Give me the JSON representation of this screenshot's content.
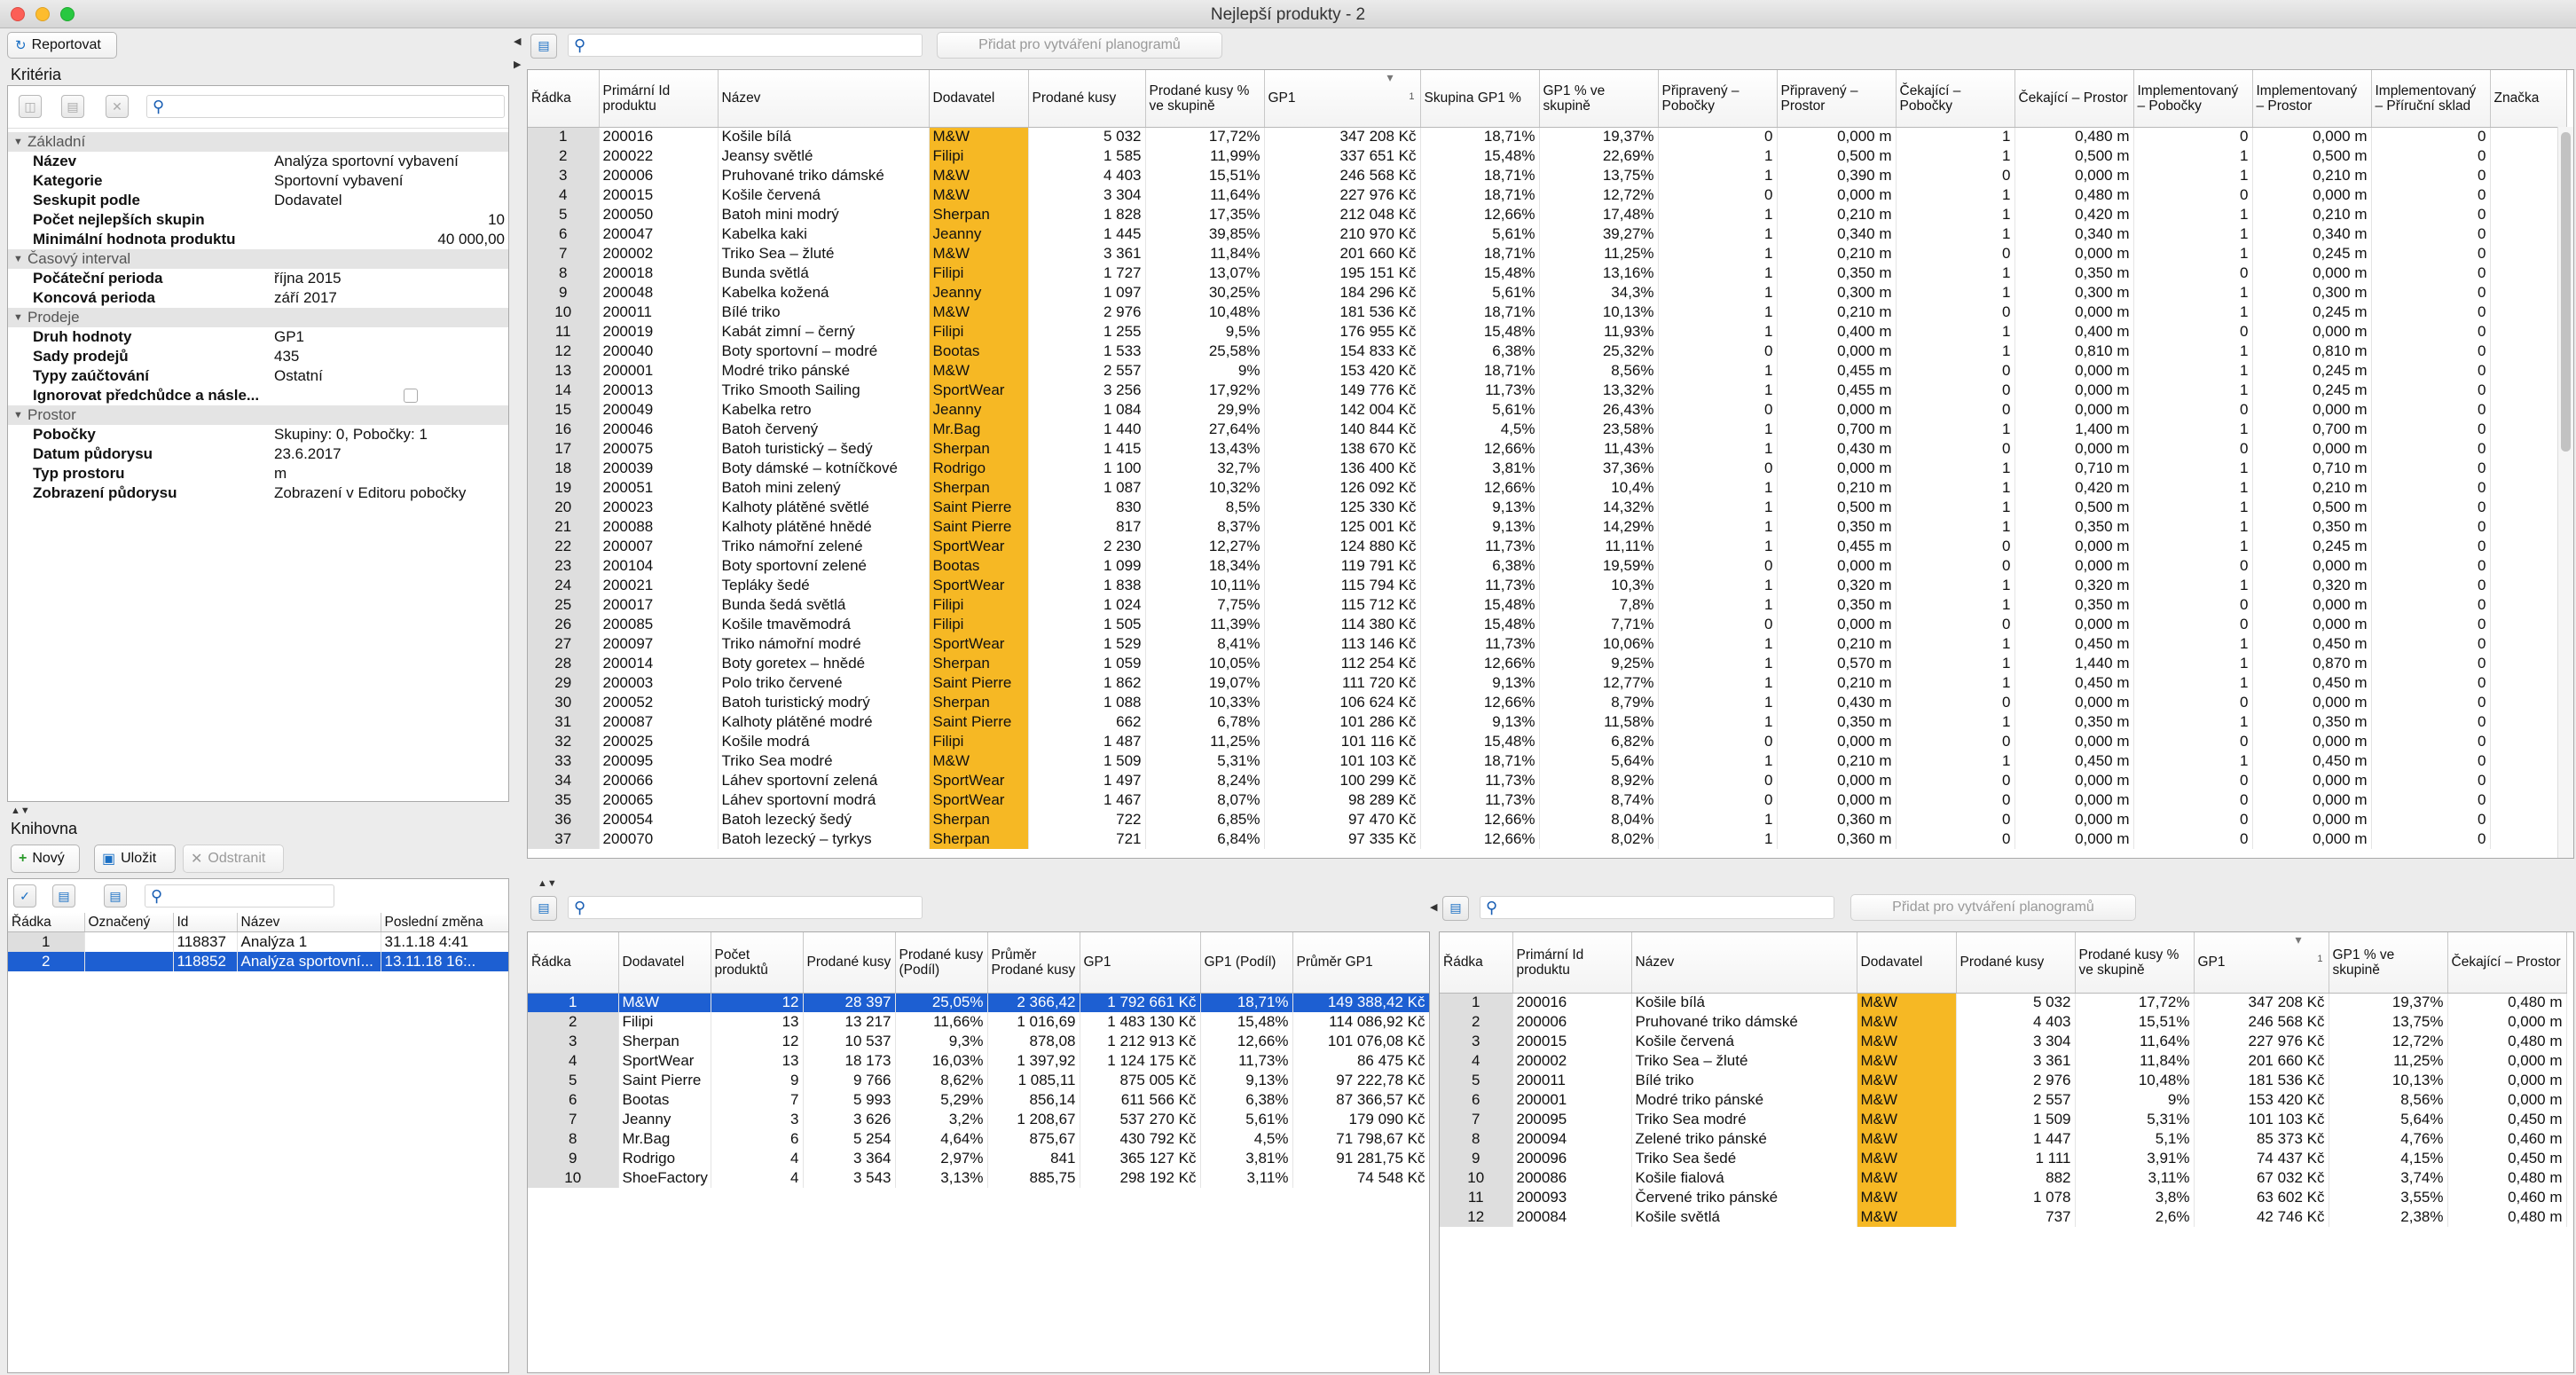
{
  "window": {
    "title": "Nejlepší produkty - 2"
  },
  "left": {
    "report_button": "Reportovat",
    "criteria_title": "Kritéria",
    "criteria_sections": [
      {
        "title": "Základní",
        "rows": [
          {
            "label": "Název",
            "value": "Analýza sportovní vybavení",
            "align": "left"
          },
          {
            "label": "Kategorie",
            "value": "Sportovní vybavení",
            "align": "left"
          },
          {
            "label": "Seskupit podle",
            "value": "Dodavatel",
            "align": "left"
          },
          {
            "label": "Počet nejlepších skupin",
            "value": "10",
            "align": "right"
          },
          {
            "label": "Minimální hodnota produktu",
            "value": "40 000,00",
            "align": "right"
          }
        ]
      },
      {
        "title": "Časový interval",
        "rows": [
          {
            "label": "Počáteční perioda",
            "value": "října 2015",
            "align": "left"
          },
          {
            "label": "Koncová perioda",
            "value": "září 2017",
            "align": "left"
          }
        ]
      },
      {
        "title": "Prodeje",
        "rows": [
          {
            "label": "Druh hodnoty",
            "value": "GP1",
            "align": "left"
          },
          {
            "label": "Sady prodejů",
            "value": "435",
            "align": "left"
          },
          {
            "label": "Typy zaúčtování",
            "value": "Ostatní",
            "align": "left"
          },
          {
            "label": "Ignorovat předchůdce a násle...",
            "value": "",
            "align": "checkbox"
          }
        ]
      },
      {
        "title": "Prostor",
        "rows": [
          {
            "label": "Pobočky",
            "value": "Skupiny: 0, Pobočky: 1",
            "align": "left"
          },
          {
            "label": "Datum půdorysu",
            "value": "23.6.2017",
            "align": "left"
          },
          {
            "label": "Typ prostoru",
            "value": "m",
            "align": "left"
          },
          {
            "label": "Zobrazení půdorysu",
            "value": "Zobrazení v Editoru pobočky",
            "align": "left"
          }
        ]
      }
    ],
    "library_title": "Knihovna",
    "new_button": "Nový",
    "save_button": "Uložit",
    "remove_button": "Odstranit",
    "library_columns": [
      "Řádka",
      "Označený",
      "Id",
      "Název",
      "Poslední změna"
    ],
    "library_rows": [
      [
        "1",
        "",
        "118837",
        "Analýza 1",
        "31.1.18 4:41"
      ],
      [
        "2",
        "",
        "118852",
        "Analýza sportovní...",
        "13.11.18 16:.."
      ]
    ],
    "library_selected": 1
  },
  "top": {
    "add_button": "Přidat pro vytváření planogramů",
    "columns": [
      "Řádka",
      "Primární Id produktu",
      "Název",
      "Dodavatel",
      "Prodané kusy",
      "Prodané kusy % ve skupině",
      "GP1",
      "Skupina GP1 %",
      "GP1 % ve skupině",
      "Připravený – Pobočky",
      "Připravený – Prostor",
      "Čekající – Pobočky",
      "Čekající – Prostor",
      "Implementovaný – Pobočky",
      "Implementovaný – Prostor",
      "Implementovaný – Příruční sklad",
      "Značka"
    ],
    "sort_marker": "1",
    "rows": [
      [
        "1",
        "200016",
        "Košile bílá",
        "M&W",
        "5 032",
        "17,72%",
        "347 208 Kč",
        "18,71%",
        "19,37%",
        "0",
        "0,000 m",
        "1",
        "0,480 m",
        "0",
        "0,000 m",
        "0"
      ],
      [
        "2",
        "200022",
        "Jeansy světlé",
        "Filipi",
        "1 585",
        "11,99%",
        "337 651 Kč",
        "15,48%",
        "22,69%",
        "1",
        "0,500 m",
        "1",
        "0,500 m",
        "1",
        "0,500 m",
        "0"
      ],
      [
        "3",
        "200006",
        "Pruhované triko dámské",
        "M&W",
        "4 403",
        "15,51%",
        "246 568 Kč",
        "18,71%",
        "13,75%",
        "1",
        "0,390 m",
        "0",
        "0,000 m",
        "1",
        "0,210 m",
        "0"
      ],
      [
        "4",
        "200015",
        "Košile červená",
        "M&W",
        "3 304",
        "11,64%",
        "227 976 Kč",
        "18,71%",
        "12,72%",
        "0",
        "0,000 m",
        "1",
        "0,480 m",
        "0",
        "0,000 m",
        "0"
      ],
      [
        "5",
        "200050",
        "Batoh mini modrý",
        "Sherpan",
        "1 828",
        "17,35%",
        "212 048 Kč",
        "12,66%",
        "17,48%",
        "1",
        "0,210 m",
        "1",
        "0,420 m",
        "1",
        "0,210 m",
        "0"
      ],
      [
        "6",
        "200047",
        "Kabelka kaki",
        "Jeanny",
        "1 445",
        "39,85%",
        "210 970 Kč",
        "5,61%",
        "39,27%",
        "1",
        "0,340 m",
        "1",
        "0,340 m",
        "1",
        "0,340 m",
        "0"
      ],
      [
        "7",
        "200002",
        "Triko Sea – žluté",
        "M&W",
        "3 361",
        "11,84%",
        "201 660 Kč",
        "18,71%",
        "11,25%",
        "1",
        "0,210 m",
        "0",
        "0,000 m",
        "1",
        "0,245 m",
        "0"
      ],
      [
        "8",
        "200018",
        "Bunda světlá",
        "Filipi",
        "1 727",
        "13,07%",
        "195 151 Kč",
        "15,48%",
        "13,16%",
        "1",
        "0,350 m",
        "1",
        "0,350 m",
        "0",
        "0,000 m",
        "0"
      ],
      [
        "9",
        "200048",
        "Kabelka kožená",
        "Jeanny",
        "1 097",
        "30,25%",
        "184 296 Kč",
        "5,61%",
        "34,3%",
        "1",
        "0,300 m",
        "1",
        "0,300 m",
        "1",
        "0,300 m",
        "0"
      ],
      [
        "10",
        "200011",
        "Bílé triko",
        "M&W",
        "2 976",
        "10,48%",
        "181 536 Kč",
        "18,71%",
        "10,13%",
        "1",
        "0,210 m",
        "0",
        "0,000 m",
        "1",
        "0,245 m",
        "0"
      ],
      [
        "11",
        "200019",
        "Kabát zimní – černý",
        "Filipi",
        "1 255",
        "9,5%",
        "176 955 Kč",
        "15,48%",
        "11,93%",
        "1",
        "0,400 m",
        "1",
        "0,400 m",
        "0",
        "0,000 m",
        "0"
      ],
      [
        "12",
        "200040",
        "Boty sportovní – modré",
        "Bootas",
        "1 533",
        "25,58%",
        "154 833 Kč",
        "6,38%",
        "25,32%",
        "0",
        "0,000 m",
        "1",
        "0,810 m",
        "1",
        "0,810 m",
        "0"
      ],
      [
        "13",
        "200001",
        "Modré triko pánské",
        "M&W",
        "2 557",
        "9%",
        "153 420 Kč",
        "18,71%",
        "8,56%",
        "1",
        "0,455 m",
        "0",
        "0,000 m",
        "1",
        "0,245 m",
        "0"
      ],
      [
        "14",
        "200013",
        "Triko Smooth Sailing",
        "SportWear",
        "3 256",
        "17,92%",
        "149 776 Kč",
        "11,73%",
        "13,32%",
        "1",
        "0,455 m",
        "0",
        "0,000 m",
        "1",
        "0,245 m",
        "0"
      ],
      [
        "15",
        "200049",
        "Kabelka retro",
        "Jeanny",
        "1 084",
        "29,9%",
        "142 004 Kč",
        "5,61%",
        "26,43%",
        "0",
        "0,000 m",
        "0",
        "0,000 m",
        "0",
        "0,000 m",
        "0"
      ],
      [
        "16",
        "200046",
        "Batoh červený",
        "Mr.Bag",
        "1 440",
        "27,64%",
        "140 844 Kč",
        "4,5%",
        "23,58%",
        "1",
        "0,700 m",
        "1",
        "1,400 m",
        "1",
        "0,700 m",
        "0"
      ],
      [
        "17",
        "200075",
        "Batoh turistický – šedý",
        "Sherpan",
        "1 415",
        "13,43%",
        "138 670 Kč",
        "12,66%",
        "11,43%",
        "1",
        "0,430 m",
        "0",
        "0,000 m",
        "0",
        "0,000 m",
        "0"
      ],
      [
        "18",
        "200039",
        "Boty dámské – kotníčkové",
        "Rodrigo",
        "1 100",
        "32,7%",
        "136 400 Kč",
        "3,81%",
        "37,36%",
        "0",
        "0,000 m",
        "1",
        "0,710 m",
        "1",
        "0,710 m",
        "0"
      ],
      [
        "19",
        "200051",
        "Batoh mini zelený",
        "Sherpan",
        "1 087",
        "10,32%",
        "126 092 Kč",
        "12,66%",
        "10,4%",
        "1",
        "0,210 m",
        "1",
        "0,420 m",
        "1",
        "0,210 m",
        "0"
      ],
      [
        "20",
        "200023",
        "Kalhoty plátěné světlé",
        "Saint Pierre",
        "830",
        "8,5%",
        "125 330 Kč",
        "9,13%",
        "14,32%",
        "1",
        "0,500 m",
        "1",
        "0,500 m",
        "1",
        "0,500 m",
        "0"
      ],
      [
        "21",
        "200088",
        "Kalhoty plátěné hnědé",
        "Saint Pierre",
        "817",
        "8,37%",
        "125 001 Kč",
        "9,13%",
        "14,29%",
        "1",
        "0,350 m",
        "1",
        "0,350 m",
        "1",
        "0,350 m",
        "0"
      ],
      [
        "22",
        "200007",
        "Triko námořní zelené",
        "SportWear",
        "2 230",
        "12,27%",
        "124 880 Kč",
        "11,73%",
        "11,11%",
        "1",
        "0,455 m",
        "0",
        "0,000 m",
        "1",
        "0,245 m",
        "0"
      ],
      [
        "23",
        "200104",
        "Boty sportovní zelené",
        "Bootas",
        "1 099",
        "18,34%",
        "119 791 Kč",
        "6,38%",
        "19,59%",
        "0",
        "0,000 m",
        "0",
        "0,000 m",
        "0",
        "0,000 m",
        "0"
      ],
      [
        "24",
        "200021",
        "Tepláky šedé",
        "SportWear",
        "1 838",
        "10,11%",
        "115 794 Kč",
        "11,73%",
        "10,3%",
        "1",
        "0,320 m",
        "1",
        "0,320 m",
        "1",
        "0,320 m",
        "0"
      ],
      [
        "25",
        "200017",
        "Bunda šedá světlá",
        "Filipi",
        "1 024",
        "7,75%",
        "115 712 Kč",
        "15,48%",
        "7,8%",
        "1",
        "0,350 m",
        "1",
        "0,350 m",
        "0",
        "0,000 m",
        "0"
      ],
      [
        "26",
        "200085",
        "Košile tmavěmodrá",
        "Filipi",
        "1 505",
        "11,39%",
        "114 380 Kč",
        "15,48%",
        "7,71%",
        "0",
        "0,000 m",
        "0",
        "0,000 m",
        "0",
        "0,000 m",
        "0"
      ],
      [
        "27",
        "200097",
        "Triko námořní modré",
        "SportWear",
        "1 529",
        "8,41%",
        "113 146 Kč",
        "11,73%",
        "10,06%",
        "1",
        "0,210 m",
        "1",
        "0,450 m",
        "1",
        "0,450 m",
        "0"
      ],
      [
        "28",
        "200014",
        "Boty goretex – hnědé",
        "Sherpan",
        "1 059",
        "10,05%",
        "112 254 Kč",
        "12,66%",
        "9,25%",
        "1",
        "0,570 m",
        "1",
        "1,440 m",
        "1",
        "0,870 m",
        "0"
      ],
      [
        "29",
        "200003",
        "Polo triko červené",
        "Saint Pierre",
        "1 862",
        "19,07%",
        "111 720 Kč",
        "9,13%",
        "12,77%",
        "1",
        "0,210 m",
        "1",
        "0,450 m",
        "1",
        "0,450 m",
        "0"
      ],
      [
        "30",
        "200052",
        "Batoh turistický modrý",
        "Sherpan",
        "1 088",
        "10,33%",
        "106 624 Kč",
        "12,66%",
        "8,79%",
        "1",
        "0,430 m",
        "0",
        "0,000 m",
        "0",
        "0,000 m",
        "0"
      ],
      [
        "31",
        "200087",
        "Kalhoty plátěné modré",
        "Saint Pierre",
        "662",
        "6,78%",
        "101 286 Kč",
        "9,13%",
        "11,58%",
        "1",
        "0,350 m",
        "1",
        "0,350 m",
        "1",
        "0,350 m",
        "0"
      ],
      [
        "32",
        "200025",
        "Košile modrá",
        "Filipi",
        "1 487",
        "11,25%",
        "101 116 Kč",
        "15,48%",
        "6,82%",
        "0",
        "0,000 m",
        "0",
        "0,000 m",
        "0",
        "0,000 m",
        "0"
      ],
      [
        "33",
        "200095",
        "Triko Sea modré",
        "M&W",
        "1 509",
        "5,31%",
        "101 103 Kč",
        "18,71%",
        "5,64%",
        "1",
        "0,210 m",
        "1",
        "0,450 m",
        "1",
        "0,450 m",
        "0"
      ],
      [
        "34",
        "200066",
        "Láhev sportovní zelená",
        "SportWear",
        "1 497",
        "8,24%",
        "100 299 Kč",
        "11,73%",
        "8,92%",
        "0",
        "0,000 m",
        "0",
        "0,000 m",
        "0",
        "0,000 m",
        "0"
      ],
      [
        "35",
        "200065",
        "Láhev sportovní modrá",
        "SportWear",
        "1 467",
        "8,07%",
        "98 289 Kč",
        "11,73%",
        "8,74%",
        "0",
        "0,000 m",
        "0",
        "0,000 m",
        "0",
        "0,000 m",
        "0"
      ],
      [
        "36",
        "200054",
        "Batoh lezecký šedý",
        "Sherpan",
        "722",
        "6,85%",
        "97 470 Kč",
        "12,66%",
        "8,04%",
        "1",
        "0,360 m",
        "0",
        "0,000 m",
        "0",
        "0,000 m",
        "0"
      ],
      [
        "37",
        "200070",
        "Batoh lezecký – tyrkys",
        "Sherpan",
        "721",
        "6,84%",
        "97 335 Kč",
        "12,66%",
        "8,02%",
        "1",
        "0,360 m",
        "0",
        "0,000 m",
        "0",
        "0,000 m",
        "0"
      ]
    ]
  },
  "bottom_left": {
    "columns": [
      "Řádka",
      "Dodavatel",
      "Počet produktů",
      "Prodané kusy",
      "Prodané kusy (Podíl)",
      "Průměr Prodané kusy",
      "GP1",
      "GP1 (Podíl)",
      "Průměr GP1"
    ],
    "selected": 0,
    "rows": [
      [
        "1",
        "M&W",
        "12",
        "28 397",
        "25,05%",
        "2 366,42",
        "1 792 661 Kč",
        "18,71%",
        "149 388,42 Kč"
      ],
      [
        "2",
        "Filipi",
        "13",
        "13 217",
        "11,66%",
        "1 016,69",
        "1 483 130 Kč",
        "15,48%",
        "114 086,92 Kč"
      ],
      [
        "3",
        "Sherpan",
        "12",
        "10 537",
        "9,3%",
        "878,08",
        "1 212 913 Kč",
        "12,66%",
        "101 076,08 Kč"
      ],
      [
        "4",
        "SportWear",
        "13",
        "18 173",
        "16,03%",
        "1 397,92",
        "1 124 175 Kč",
        "11,73%",
        "86 475 Kč"
      ],
      [
        "5",
        "Saint Pierre",
        "9",
        "9 766",
        "8,62%",
        "1 085,11",
        "875 005 Kč",
        "9,13%",
        "97 222,78 Kč"
      ],
      [
        "6",
        "Bootas",
        "7",
        "5 993",
        "5,29%",
        "856,14",
        "611 566 Kč",
        "6,38%",
        "87 366,57 Kč"
      ],
      [
        "7",
        "Jeanny",
        "3",
        "3 626",
        "3,2%",
        "1 208,67",
        "537 270 Kč",
        "5,61%",
        "179 090 Kč"
      ],
      [
        "8",
        "Mr.Bag",
        "6",
        "5 254",
        "4,64%",
        "875,67",
        "430 792 Kč",
        "4,5%",
        "71 798,67 Kč"
      ],
      [
        "9",
        "Rodrigo",
        "4",
        "3 364",
        "2,97%",
        "841",
        "365 127 Kč",
        "3,81%",
        "91 281,75 Kč"
      ],
      [
        "10",
        "ShoeFactory",
        "4",
        "3 543",
        "3,13%",
        "885,75",
        "298 192 Kč",
        "3,11%",
        "74 548 Kč"
      ]
    ]
  },
  "bottom_right": {
    "add_button": "Přidat pro vytváření planogramů",
    "columns": [
      "Řádka",
      "Primární Id produktu",
      "Název",
      "Dodavatel",
      "Prodané kusy",
      "Prodané kusy % ve skupině",
      "GP1",
      "GP1 % ve skupině",
      "Čekající – Prostor"
    ],
    "sort_marker": "1",
    "rows": [
      [
        "1",
        "200016",
        "Košile bílá",
        "M&W",
        "5 032",
        "17,72%",
        "347 208 Kč",
        "19,37%",
        "0,480 m"
      ],
      [
        "2",
        "200006",
        "Pruhované triko dámské",
        "M&W",
        "4 403",
        "15,51%",
        "246 568 Kč",
        "13,75%",
        "0,000 m"
      ],
      [
        "3",
        "200015",
        "Košile červená",
        "M&W",
        "3 304",
        "11,64%",
        "227 976 Kč",
        "12,72%",
        "0,480 m"
      ],
      [
        "4",
        "200002",
        "Triko Sea – žluté",
        "M&W",
        "3 361",
        "11,84%",
        "201 660 Kč",
        "11,25%",
        "0,000 m"
      ],
      [
        "5",
        "200011",
        "Bílé triko",
        "M&W",
        "2 976",
        "10,48%",
        "181 536 Kč",
        "10,13%",
        "0,000 m"
      ],
      [
        "6",
        "200001",
        "Modré triko pánské",
        "M&W",
        "2 557",
        "9%",
        "153 420 Kč",
        "8,56%",
        "0,000 m"
      ],
      [
        "7",
        "200095",
        "Triko Sea modré",
        "M&W",
        "1 509",
        "5,31%",
        "101 103 Kč",
        "5,64%",
        "0,450 m"
      ],
      [
        "8",
        "200094",
        "Zelené triko pánské",
        "M&W",
        "1 447",
        "5,1%",
        "85 373 Kč",
        "4,76%",
        "0,460 m"
      ],
      [
        "9",
        "200096",
        "Triko Sea šedé",
        "M&W",
        "1 111",
        "3,91%",
        "74 437 Kč",
        "4,15%",
        "0,450 m"
      ],
      [
        "10",
        "200086",
        "Košile fialová",
        "M&W",
        "882",
        "3,11%",
        "67 032 Kč",
        "3,74%",
        "0,480 m"
      ],
      [
        "11",
        "200093",
        "Červené triko pánské",
        "M&W",
        "1 078",
        "3,8%",
        "63 602 Kč",
        "3,55%",
        "0,460 m"
      ],
      [
        "12",
        "200084",
        "Košile světlá",
        "M&W",
        "737",
        "2,6%",
        "42 746 Kč",
        "2,38%",
        "0,480 m"
      ]
    ]
  },
  "colors": {
    "supplier_highlight": "#f6b824",
    "selection": "#1d5fd2"
  }
}
